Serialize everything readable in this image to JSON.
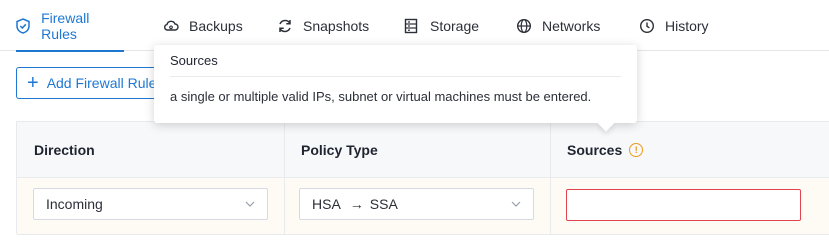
{
  "tabs": [
    {
      "label": "Firewall Rules",
      "icon": "shield-check-icon",
      "active": true
    },
    {
      "label": "Backups",
      "icon": "cloud-backup-icon"
    },
    {
      "label": "Snapshots",
      "icon": "refresh-icon"
    },
    {
      "label": "Storage",
      "icon": "storage-icon"
    },
    {
      "label": "Networks",
      "icon": "globe-icon"
    },
    {
      "label": "History",
      "icon": "clock-icon"
    }
  ],
  "toolbar": {
    "add_label": "Add Firewall Rule"
  },
  "table": {
    "headers": {
      "direction": "Direction",
      "policy_type": "Policy Type",
      "sources": "Sources"
    },
    "row": {
      "direction": "Incoming",
      "policy_from": "HSA",
      "policy_arrow": "→",
      "policy_to": "SSA",
      "sources_value": ""
    }
  },
  "tooltip": {
    "title": "Sources",
    "body": "a single or multiple valid IPs, subnet or virtual machines must be entered."
  },
  "colors": {
    "accent": "#1e78d2",
    "warning": "#e99a1d",
    "error": "#e0454f"
  }
}
